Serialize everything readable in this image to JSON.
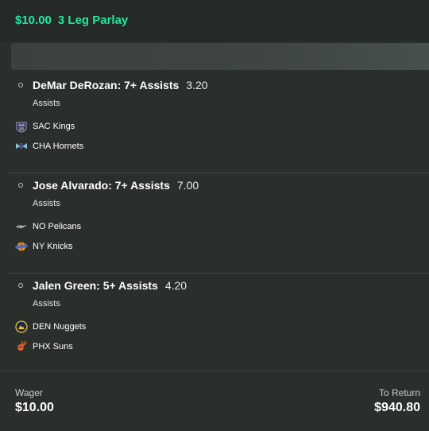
{
  "header": {
    "stake": "$10.00",
    "bet_type": "3 Leg Parlay"
  },
  "legs": [
    {
      "player_pick": "DeMar DeRozan: 7+ Assists",
      "odds": "3.20",
      "market": "Assists",
      "teams": [
        {
          "name": "SAC Kings",
          "icon": "kings-logo-icon"
        },
        {
          "name": "CHA Hornets",
          "icon": "hornets-logo-icon"
        }
      ]
    },
    {
      "player_pick": "Jose Alvarado: 7+ Assists",
      "odds": "7.00",
      "market": "Assists",
      "teams": [
        {
          "name": "NO Pelicans",
          "icon": "pelicans-logo-icon"
        },
        {
          "name": "NY Knicks",
          "icon": "knicks-logo-icon"
        }
      ]
    },
    {
      "player_pick": "Jalen Green: 5+ Assists",
      "odds": "4.20",
      "market": "Assists",
      "teams": [
        {
          "name": "DEN Nuggets",
          "icon": "nuggets-logo-icon"
        },
        {
          "name": "PHX Suns",
          "icon": "suns-logo-icon"
        }
      ]
    }
  ],
  "footer": {
    "wager_label": "Wager",
    "wager_value": "$10.00",
    "return_label": "To Return",
    "return_value": "$940.80"
  },
  "colors": {
    "accent": "#22e6a0",
    "background": "#2b2f2c"
  }
}
